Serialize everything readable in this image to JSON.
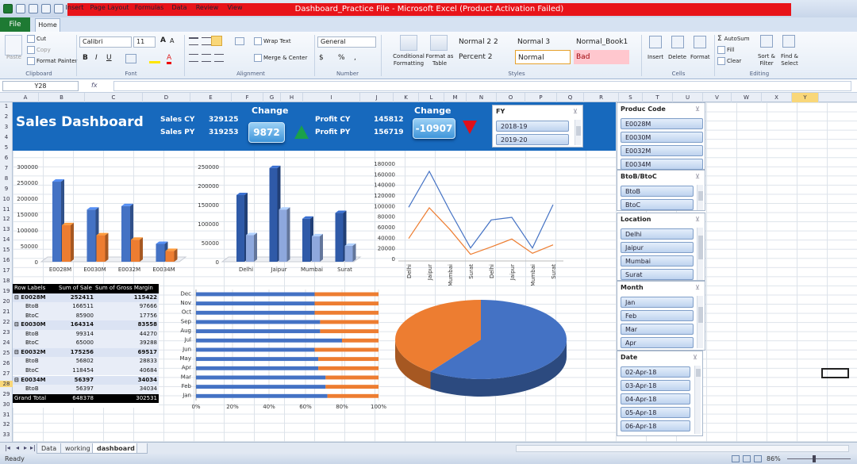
{
  "window": {
    "title": "Dashboard_Practice File - Microsoft Excel (Product Activation Failed)"
  },
  "ribbon_tabs": [
    "Home",
    "Insert",
    "Page Layout",
    "Formulas",
    "Data",
    "Review",
    "View"
  ],
  "file_tab": "File",
  "ribbon": {
    "clipboard": {
      "paste": "Paste",
      "cut": "Cut",
      "copy": "Copy",
      "format_painter": "Format Painter",
      "group": "Clipboard"
    },
    "font": {
      "name": "Calibri",
      "size": "11",
      "group": "Font"
    },
    "alignment": {
      "wrap": "Wrap Text",
      "merge": "Merge & Center",
      "group": "Alignment"
    },
    "number": {
      "format": "General",
      "group": "Number"
    },
    "styles": {
      "cond": "Conditional Formatting",
      "table": "Format as Table",
      "normal22": "Normal 2 2",
      "normal3": "Normal 3",
      "normalbook": "Normal_Book1",
      "percent2": "Percent 2",
      "normal": "Normal",
      "bad": "Bad",
      "group": "Styles"
    },
    "cells": {
      "insert": "Insert",
      "delete": "Delete",
      "format": "Format",
      "group": "Cells"
    },
    "editing": {
      "autosum": "AutoSum",
      "fill": "Fill",
      "clear": "Clear",
      "sort": "Sort & Filter",
      "find": "Find & Select",
      "group": "Editing"
    }
  },
  "formula_bar": {
    "name_box": "Y28",
    "fx": "fx",
    "formula": ""
  },
  "columns": [
    "A",
    "B",
    "C",
    "D",
    "E",
    "F",
    "G",
    "H",
    "I",
    "J",
    "K",
    "L",
    "M",
    "N",
    "O",
    "P",
    "Q",
    "R",
    "S",
    "T",
    "U",
    "V",
    "W",
    "X",
    "Y"
  ],
  "rows": [
    "1",
    "2",
    "3",
    "4",
    "5",
    "6",
    "7",
    "8",
    "9",
    "10",
    "11",
    "12",
    "13",
    "14",
    "15",
    "16",
    "17",
    "18",
    "19",
    "20",
    "21",
    "22",
    "23",
    "24",
    "25",
    "26",
    "27",
    "28",
    "29",
    "30",
    "31",
    "32",
    "33"
  ],
  "dashboard": {
    "title": "Sales Dashboard",
    "sales_cy_label": "Sales CY",
    "sales_cy": "329125",
    "sales_py_label": "Sales PY",
    "sales_py": "319253",
    "change_label": "Change",
    "sales_change": "9872",
    "profit_cy_label": "Profit CY",
    "profit_cy": "145812",
    "profit_py_label": "Profit PY",
    "profit_py": "156719",
    "profit_change": "-10907",
    "colors": {
      "banner": "#1769bd",
      "up": "#1aa14a",
      "down": "#e0101a",
      "blue": "#4472c4",
      "orange": "#ed7d31"
    }
  },
  "slicers": {
    "fy": {
      "title": "FY",
      "items": [
        "2018-19",
        "2019-20"
      ]
    },
    "product": {
      "title": "Produc Code",
      "items": [
        "E0028M",
        "E0030M",
        "E0032M",
        "E0034M"
      ]
    },
    "btob": {
      "title": "BtoB/BtoC",
      "items": [
        "BtoB",
        "BtoC"
      ]
    },
    "location": {
      "title": "Location",
      "items": [
        "Delhi",
        "Jaipur",
        "Mumbai",
        "Surat"
      ]
    },
    "month": {
      "title": "Month",
      "items": [
        "Jan",
        "Feb",
        "Mar",
        "Apr"
      ]
    },
    "date": {
      "title": "Date",
      "items": [
        "02-Apr-18",
        "03-Apr-18",
        "04-Apr-18",
        "05-Apr-18",
        "06-Apr-18"
      ]
    }
  },
  "pivot": {
    "headers": [
      "Row Labels",
      "Sum of Sale",
      "Sum of Gross Margin"
    ],
    "rows": [
      {
        "label": "E0028M",
        "sale": "252411",
        "gm": "115422",
        "bold": true
      },
      {
        "label": "BtoB",
        "sale": "166511",
        "gm": "97666",
        "bold": false
      },
      {
        "label": "BtoC",
        "sale": "85900",
        "gm": "17756",
        "bold": false
      },
      {
        "label": "E0030M",
        "sale": "164314",
        "gm": "83558",
        "bold": true
      },
      {
        "label": "BtoB",
        "sale": "99314",
        "gm": "44270",
        "bold": false
      },
      {
        "label": "BtoC",
        "sale": "65000",
        "gm": "39288",
        "bold": false
      },
      {
        "label": "E0032M",
        "sale": "175256",
        "gm": "69517",
        "bold": true
      },
      {
        "label": "BtoB",
        "sale": "56802",
        "gm": "28833",
        "bold": false
      },
      {
        "label": "BtoC",
        "sale": "118454",
        "gm": "40684",
        "bold": false
      },
      {
        "label": "E0034M",
        "sale": "56397",
        "gm": "34034",
        "bold": true
      },
      {
        "label": "BtoB",
        "sale": "56397",
        "gm": "34034",
        "bold": false
      }
    ],
    "total": {
      "label": "Grand Total",
      "sale": "648378",
      "gm": "302531"
    }
  },
  "sheet_tabs": [
    "Data",
    "working",
    "dashboard"
  ],
  "status": {
    "ready": "Ready",
    "zoom": "86%"
  },
  "chart_data": [
    {
      "type": "bar",
      "categories": [
        "E0028M",
        "E0030M",
        "E0032M",
        "E0034M"
      ],
      "series": [
        {
          "values": [
            252411,
            164314,
            175256,
            56397
          ]
        },
        {
          "values": [
            115422,
            83558,
            69517,
            34034
          ]
        }
      ],
      "ylim": [
        0,
        300000
      ],
      "yticks": [
        "0",
        "50000",
        "100000",
        "150000",
        "200000",
        "250000",
        "300000"
      ],
      "colors": [
        "#4472c4",
        "#ed7d31"
      ]
    },
    {
      "type": "bar",
      "categories": [
        "Delhi",
        "Jaipur",
        "Mumbai",
        "Surat"
      ],
      "series": [
        {
          "values": [
            175000,
            246000,
            113000,
            128000
          ]
        },
        {
          "values": [
            70000,
            137000,
            67000,
            42000
          ]
        }
      ],
      "ylim": [
        0,
        250000
      ],
      "yticks": [
        "0",
        "50000",
        "100000",
        "150000",
        "200000",
        "250000"
      ],
      "colors": [
        "#2f5aa8",
        "#8ea8dd"
      ]
    },
    {
      "type": "line",
      "categories": [
        "Delhi",
        "Jaipur",
        "Mumbai",
        "Surat",
        "Delhi",
        "Jaipur",
        "Mumbai",
        "Surat"
      ],
      "series": [
        {
          "values": [
            97000,
            165000,
            90000,
            20000,
            73000,
            78000,
            20000,
            102000
          ]
        },
        {
          "values": [
            38000,
            96000,
            55000,
            8000,
            22000,
            37000,
            10000,
            26000
          ]
        }
      ],
      "ylim": [
        0,
        180000
      ],
      "yticks": [
        "0",
        "20000",
        "40000",
        "60000",
        "80000",
        "100000",
        "120000",
        "140000",
        "160000",
        "180000"
      ],
      "colors": [
        "#4472c4",
        "#ed7d31"
      ]
    },
    {
      "type": "bar",
      "orientation": "horizontal-100%",
      "categories": [
        "Jan",
        "Feb",
        "Mar",
        "Apr",
        "May",
        "Jun",
        "Jul",
        "Aug",
        "Sep",
        "Oct",
        "Nov",
        "Dec"
      ],
      "series": [
        {
          "values": [
            72,
            71,
            71,
            67,
            67,
            65,
            80,
            68,
            68,
            65,
            65,
            65
          ]
        },
        {
          "values": [
            28,
            29,
            29,
            33,
            33,
            35,
            20,
            32,
            32,
            35,
            35,
            35
          ]
        }
      ],
      "xticks": [
        "0%",
        "20%",
        "40%",
        "60%",
        "80%",
        "100%"
      ],
      "colors": [
        "#4472c4",
        "#ed7d31"
      ]
    },
    {
      "type": "pie",
      "series": [
        {
          "values": [
            60,
            40
          ]
        }
      ],
      "colors": [
        "#4472c4",
        "#ed7d31"
      ]
    }
  ]
}
